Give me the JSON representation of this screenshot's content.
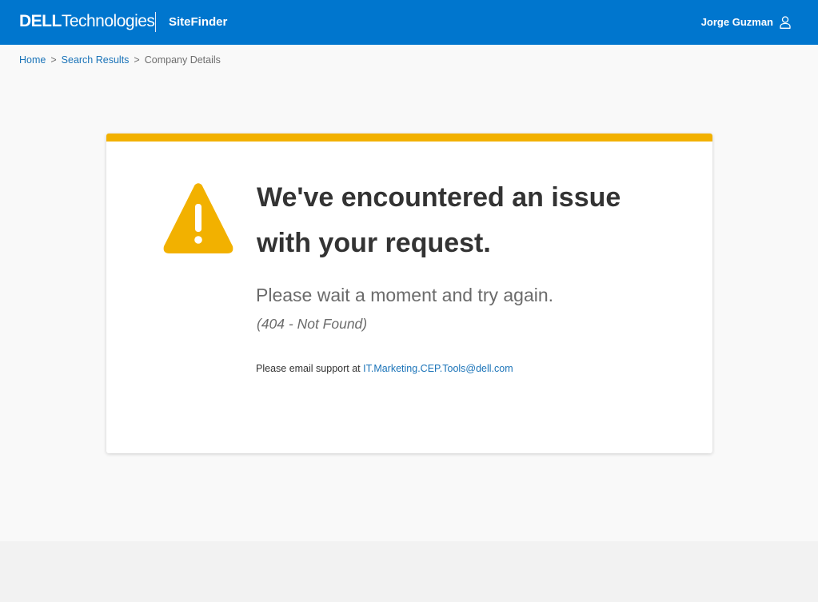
{
  "header": {
    "logo_brand": "DELL",
    "logo_suffix": "Technologies",
    "app_name": "SiteFinder",
    "user_name": "Jorge Guzman",
    "icon": "user-icon"
  },
  "breadcrumb": {
    "items": [
      {
        "label": "Home"
      },
      {
        "label": "Search Results"
      },
      {
        "label": "Company Details"
      }
    ],
    "separator": ">"
  },
  "error": {
    "icon": "warning-icon",
    "title": "We've encountered an issue with your request.",
    "subtitle": "Please wait a moment and try again.",
    "code": "(404 - Not Found)",
    "support_prefix": "Please email support at",
    "support_email": "IT.Marketing.CEP.Tools@dell.com"
  },
  "colors": {
    "header": "#0076ce",
    "accent_warning": "#f2b100",
    "link": "#1a73b8"
  }
}
